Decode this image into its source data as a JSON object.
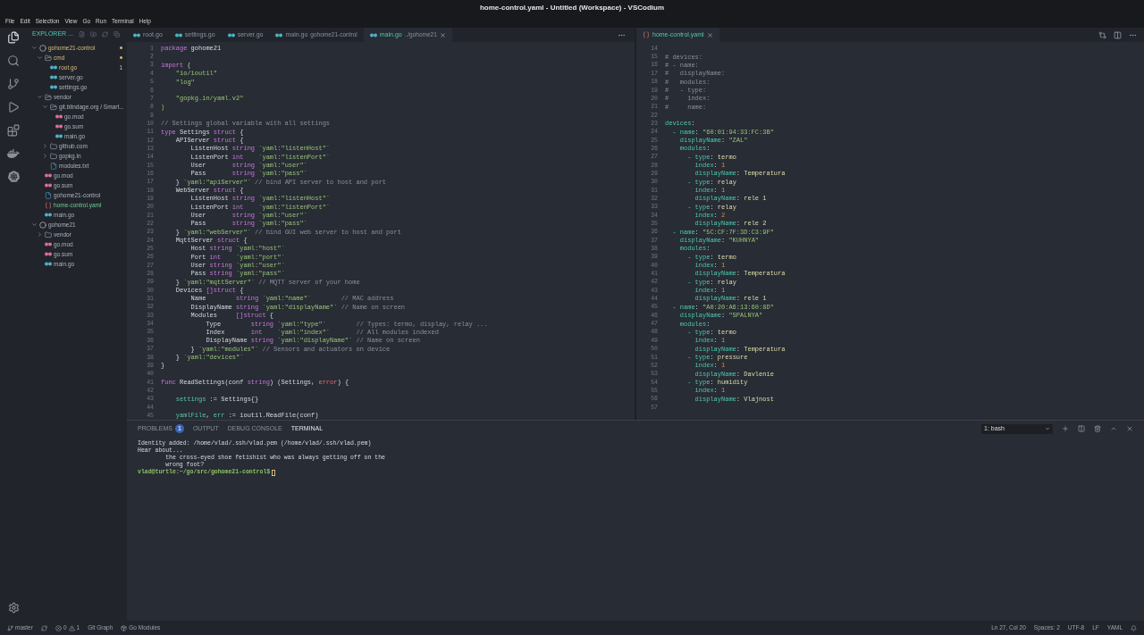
{
  "window": {
    "title": "home-control.yaml - Untitled (Workspace) - VSCodium"
  },
  "menu": [
    "File",
    "Edit",
    "Selection",
    "View",
    "Go",
    "Run",
    "Terminal",
    "Help"
  ],
  "sidebar": {
    "title": "EXPLORER ...",
    "tree": [
      {
        "label": "gohome21-control",
        "kind": "root",
        "expanded": true,
        "warning": true,
        "added": false,
        "children": [
          {
            "label": "cmd",
            "kind": "folder",
            "expanded": true,
            "warning": true,
            "added": false,
            "children": [
              {
                "label": "root.go",
                "kind": "go",
                "warning": true,
                "added": false,
                "badge": "1"
              },
              {
                "label": "server.go",
                "kind": "go",
                "warning": false,
                "added": false
              },
              {
                "label": "settings.go",
                "kind": "go",
                "warning": false,
                "added": false
              }
            ]
          },
          {
            "label": "vendor",
            "kind": "folder",
            "expanded": true,
            "warning": false,
            "added": false,
            "children": [
              {
                "label": "git.blindage.org / Smart...",
                "kind": "folder",
                "expanded": true,
                "warning": false,
                "added": false,
                "children": [
                  {
                    "label": "go.mod",
                    "kind": "mod",
                    "warning": false,
                    "added": false
                  },
                  {
                    "label": "go.sum",
                    "kind": "mod",
                    "warning": false,
                    "added": false
                  },
                  {
                    "label": "main.go",
                    "kind": "go",
                    "warning": false,
                    "added": false
                  }
                ]
              },
              {
                "label": "github.com",
                "kind": "folder",
                "expanded": false,
                "warning": false,
                "added": false
              },
              {
                "label": "gopkg.in",
                "kind": "folder",
                "expanded": false,
                "warning": false,
                "added": false
              },
              {
                "label": "modules.txt",
                "kind": "text",
                "warning": false,
                "added": false
              }
            ]
          },
          {
            "label": "go.mod",
            "kind": "mod",
            "warning": false,
            "added": false
          },
          {
            "label": "go.sum",
            "kind": "mod",
            "warning": false,
            "added": false
          },
          {
            "label": "gohome21-control",
            "kind": "text",
            "warning": false,
            "added": false
          },
          {
            "label": "home-control.yaml",
            "kind": "yaml",
            "warning": false,
            "added": true
          },
          {
            "label": "main.go",
            "kind": "go",
            "warning": false,
            "added": false
          }
        ]
      },
      {
        "label": "gohome21",
        "kind": "root",
        "expanded": true,
        "warning": false,
        "added": false,
        "children": [
          {
            "label": "vendor",
            "kind": "folder",
            "expanded": false,
            "warning": false,
            "added": false
          },
          {
            "label": "go.mod",
            "kind": "mod",
            "warning": false,
            "added": false
          },
          {
            "label": "go.sum",
            "kind": "mod",
            "warning": false,
            "added": false
          },
          {
            "label": "main.go",
            "kind": "go",
            "warning": false,
            "added": false
          }
        ]
      }
    ]
  },
  "editors": [
    {
      "tabs": [
        {
          "label": "root.go",
          "kind": "go",
          "selected": false
        },
        {
          "label": "settings.go",
          "kind": "go",
          "selected": false
        },
        {
          "label": "server.go",
          "kind": "go",
          "selected": false
        },
        {
          "label": "main.go",
          "description": "gohome21-control",
          "kind": "go",
          "selected": false
        },
        {
          "label": "main.go",
          "description": "../gohome21",
          "kind": "go",
          "selected": true
        }
      ],
      "lines": [
        {
          "number": "1",
          "tokens": [
            {
              "kind": "keyword",
              "text": "package"
            },
            {
              "kind": "plain",
              "text": " gohome21"
            }
          ]
        },
        {
          "number": "2"
        },
        {
          "number": "3",
          "tokens": [
            {
              "kind": "keyword",
              "text": "import"
            },
            {
              "kind": "plain",
              "text": " ("
            }
          ]
        },
        {
          "number": "4",
          "tokens": [
            {
              "kind": "string",
              "text": "    \"io/ioutil\""
            }
          ]
        },
        {
          "number": "5",
          "tokens": [
            {
              "kind": "string",
              "text": "    \"log\""
            }
          ]
        },
        {
          "number": "6"
        },
        {
          "number": "7",
          "tokens": [
            {
              "kind": "string",
              "text": "    \"gopkg.in/yaml.v2\""
            }
          ]
        },
        {
          "number": "8",
          "tokens": [
            {
              "kind": "string",
              "text": ")"
            }
          ]
        },
        {
          "number": "9"
        },
        {
          "number": "10",
          "tokens": [
            {
              "kind": "comment",
              "text": "// Settings global variable with all settings"
            }
          ]
        },
        {
          "number": "11",
          "tokens": [
            {
              "kind": "keyword",
              "text": "type"
            },
            {
              "kind": "plain",
              "text": " Settings "
            },
            {
              "kind": "keyword",
              "text": "struct"
            },
            {
              "kind": "plain",
              "text": " {"
            }
          ]
        },
        {
          "number": "12",
          "tokens": [
            {
              "kind": "plain",
              "text": "    APIServer "
            },
            {
              "kind": "keyword",
              "text": "struct"
            },
            {
              "kind": "plain",
              "text": " {"
            }
          ]
        },
        {
          "number": "13",
          "tokens": [
            {
              "kind": "plain",
              "text": "        ListenHost "
            },
            {
              "kind": "keyword",
              "text": "string"
            },
            {
              "kind": "string",
              "text": " `yaml:\"listenHost\"`"
            }
          ]
        },
        {
          "number": "14",
          "tokens": [
            {
              "kind": "plain",
              "text": "        ListenPort "
            },
            {
              "kind": "keyword",
              "text": "int"
            },
            {
              "kind": "string",
              "text": "    `yaml:\"listenPort\"`"
            }
          ]
        },
        {
          "number": "15",
          "tokens": [
            {
              "kind": "plain",
              "text": "        User       "
            },
            {
              "kind": "keyword",
              "text": "string"
            },
            {
              "kind": "string",
              "text": " `yaml:\"user\"`"
            }
          ]
        },
        {
          "number": "16",
          "tokens": [
            {
              "kind": "plain",
              "text": "        Pass       "
            },
            {
              "kind": "keyword",
              "text": "string"
            },
            {
              "kind": "string",
              "text": " `yaml:\"pass\"`"
            }
          ]
        },
        {
          "number": "17",
          "tokens": [
            {
              "kind": "plain",
              "text": "    } "
            },
            {
              "kind": "string",
              "text": "`yaml:\"apiServer\"`"
            },
            {
              "kind": "comment",
              "text": " // bind API server to host and port"
            }
          ]
        },
        {
          "number": "18",
          "tokens": [
            {
              "kind": "plain",
              "text": "    WebServer "
            },
            {
              "kind": "keyword",
              "text": "struct"
            },
            {
              "kind": "plain",
              "text": " {"
            }
          ]
        },
        {
          "number": "19",
          "tokens": [
            {
              "kind": "plain",
              "text": "        ListenHost "
            },
            {
              "kind": "keyword",
              "text": "string"
            },
            {
              "kind": "string",
              "text": " `yaml:\"listenHost\"`"
            }
          ]
        },
        {
          "number": "20",
          "tokens": [
            {
              "kind": "plain",
              "text": "        ListenPort "
            },
            {
              "kind": "keyword",
              "text": "int"
            },
            {
              "kind": "string",
              "text": "    `yaml:\"listenPort\"`"
            }
          ]
        },
        {
          "number": "21",
          "tokens": [
            {
              "kind": "plain",
              "text": "        User       "
            },
            {
              "kind": "keyword",
              "text": "string"
            },
            {
              "kind": "string",
              "text": " `yaml:\"user\"`"
            }
          ]
        },
        {
          "number": "22",
          "tokens": [
            {
              "kind": "plain",
              "text": "        Pass       "
            },
            {
              "kind": "keyword",
              "text": "string"
            },
            {
              "kind": "string",
              "text": " `yaml:\"pass\"`"
            }
          ]
        },
        {
          "number": "23",
          "tokens": [
            {
              "kind": "plain",
              "text": "    } "
            },
            {
              "kind": "string",
              "text": "`yaml:\"webServer\"`"
            },
            {
              "kind": "comment",
              "text": " // bind GUI web server to host and port"
            }
          ]
        },
        {
          "number": "24",
          "tokens": [
            {
              "kind": "plain",
              "text": "    MqttServer "
            },
            {
              "kind": "keyword",
              "text": "struct"
            },
            {
              "kind": "plain",
              "text": " {"
            }
          ]
        },
        {
          "number": "25",
          "tokens": [
            {
              "kind": "plain",
              "text": "        Host "
            },
            {
              "kind": "keyword",
              "text": "string"
            },
            {
              "kind": "string",
              "text": " `yaml:\"host\"`"
            }
          ]
        },
        {
          "number": "26",
          "tokens": [
            {
              "kind": "plain",
              "text": "        Port "
            },
            {
              "kind": "keyword",
              "text": "int"
            },
            {
              "kind": "string",
              "text": "    `yaml:\"port\"`"
            }
          ]
        },
        {
          "number": "27",
          "tokens": [
            {
              "kind": "plain",
              "text": "        User "
            },
            {
              "kind": "keyword",
              "text": "string"
            },
            {
              "kind": "string",
              "text": " `yaml:\"user\"`"
            }
          ]
        },
        {
          "number": "28",
          "tokens": [
            {
              "kind": "plain",
              "text": "        Pass "
            },
            {
              "kind": "keyword",
              "text": "string"
            },
            {
              "kind": "string",
              "text": " `yaml:\"pass\"`"
            }
          ]
        },
        {
          "number": "29",
          "tokens": [
            {
              "kind": "plain",
              "text": "    } "
            },
            {
              "kind": "string",
              "text": "`yaml:\"mqttServer\"`"
            },
            {
              "kind": "comment",
              "text": " // MQTT server of your home"
            }
          ]
        },
        {
          "number": "30",
          "tokens": [
            {
              "kind": "plain",
              "text": "    Devices "
            },
            {
              "kind": "keyword",
              "text": "[]struct"
            },
            {
              "kind": "plain",
              "text": " {"
            }
          ]
        },
        {
          "number": "31",
          "tokens": [
            {
              "kind": "plain",
              "text": "        Name        "
            },
            {
              "kind": "keyword",
              "text": "string"
            },
            {
              "kind": "string",
              "text": " `yaml:\"name\"`"
            },
            {
              "kind": "comment",
              "text": "        // MAC address"
            }
          ]
        },
        {
          "number": "32",
          "tokens": [
            {
              "kind": "plain",
              "text": "        DisplayName "
            },
            {
              "kind": "keyword",
              "text": "string"
            },
            {
              "kind": "string",
              "text": " `yaml:\"displayName\"`"
            },
            {
              "kind": "comment",
              "text": " // Name on screen"
            }
          ]
        },
        {
          "number": "33",
          "tokens": [
            {
              "kind": "plain",
              "text": "        Modules     "
            },
            {
              "kind": "keyword",
              "text": "[]struct"
            },
            {
              "kind": "plain",
              "text": " {"
            }
          ]
        },
        {
          "number": "34",
          "tokens": [
            {
              "kind": "plain",
              "text": "            Type        "
            },
            {
              "kind": "keyword",
              "text": "string"
            },
            {
              "kind": "string",
              "text": " `yaml:\"type\"`"
            },
            {
              "kind": "comment",
              "text": "        // Types: termo, display, relay ..."
            }
          ]
        },
        {
          "number": "35",
          "tokens": [
            {
              "kind": "plain",
              "text": "            Index       "
            },
            {
              "kind": "keyword",
              "text": "int"
            },
            {
              "kind": "string",
              "text": "    `yaml:\"index\"`"
            },
            {
              "kind": "comment",
              "text": "       // All modules indexed"
            }
          ]
        },
        {
          "number": "36",
          "tokens": [
            {
              "kind": "plain",
              "text": "            DisplayName "
            },
            {
              "kind": "keyword",
              "text": "string"
            },
            {
              "kind": "string",
              "text": " `yaml:\"displayName\"`"
            },
            {
              "kind": "comment",
              "text": " // Name on screen"
            }
          ]
        },
        {
          "number": "37",
          "tokens": [
            {
              "kind": "plain",
              "text": "        } "
            },
            {
              "kind": "string",
              "text": "`yaml:\"modules\"`"
            },
            {
              "kind": "comment",
              "text": " // Sensors and actuators on device"
            }
          ]
        },
        {
          "number": "38",
          "tokens": [
            {
              "kind": "plain",
              "text": "    } "
            },
            {
              "kind": "string",
              "text": "`yaml:\"devices\"`"
            }
          ]
        },
        {
          "number": "39",
          "tokens": [
            {
              "kind": "plain",
              "text": "}"
            }
          ]
        },
        {
          "number": "40"
        },
        {
          "number": "41",
          "tokens": [
            {
              "kind": "keyword",
              "text": "func"
            },
            {
              "kind": "plain",
              "text": " ReadSettings(conf "
            },
            {
              "kind": "keyword",
              "text": "string"
            },
            {
              "kind": "plain",
              "text": ") (Settings, "
            },
            {
              "kind": "builtin",
              "text": "error"
            },
            {
              "kind": "plain",
              "text": ") {"
            }
          ]
        },
        {
          "number": "42"
        },
        {
          "number": "43",
          "tokens": [
            {
              "kind": "variable",
              "text": "    settings"
            },
            {
              "kind": "plain",
              "text": " := Settings{}"
            }
          ]
        },
        {
          "number": "44"
        },
        {
          "number": "45",
          "tokens": [
            {
              "kind": "variable",
              "text": "    yamlFile"
            },
            {
              "kind": "plain",
              "text": ", "
            },
            {
              "kind": "variable",
              "text": "err"
            },
            {
              "kind": "plain",
              "text": " := ioutil.ReadFile(conf)"
            }
          ]
        }
      ]
    },
    {
      "tabs": [
        {
          "label": "home-control.yaml",
          "kind": "yaml",
          "selected": true
        }
      ],
      "lines": [
        {
          "number": "14"
        },
        {
          "number": "15",
          "tokens": [
            {
              "kind": "comment",
              "text": "# devices:"
            }
          ]
        },
        {
          "number": "16",
          "tokens": [
            {
              "kind": "comment",
              "text": "# - name:"
            }
          ]
        },
        {
          "number": "17",
          "tokens": [
            {
              "kind": "comment",
              "text": "#   displayName:"
            }
          ]
        },
        {
          "number": "18",
          "tokens": [
            {
              "kind": "comment",
              "text": "#   modules:"
            }
          ]
        },
        {
          "number": "19",
          "tokens": [
            {
              "kind": "comment",
              "text": "#   - type:"
            }
          ]
        },
        {
          "number": "20",
          "tokens": [
            {
              "kind": "comment",
              "text": "#     index:"
            }
          ]
        },
        {
          "number": "21",
          "tokens": [
            {
              "kind": "comment",
              "text": "#     name:"
            }
          ]
        },
        {
          "number": "22"
        },
        {
          "number": "23",
          "tokens": [
            {
              "kind": "key",
              "text": "devices"
            },
            {
              "kind": "plain",
              "text": ":"
            }
          ]
        },
        {
          "number": "24",
          "tokens": [
            {
              "kind": "key",
              "text": "  - name"
            },
            {
              "kind": "plain",
              "text": ": "
            },
            {
              "kind": "string",
              "text": "\"60:01:94:33:FC:3B\""
            }
          ]
        },
        {
          "number": "25",
          "tokens": [
            {
              "kind": "key",
              "text": "    displayName"
            },
            {
              "kind": "plain",
              "text": ": "
            },
            {
              "kind": "string",
              "text": "\"ZAL\""
            }
          ]
        },
        {
          "number": "26",
          "tokens": [
            {
              "kind": "key",
              "text": "    modules"
            },
            {
              "kind": "plain",
              "text": ":"
            }
          ]
        },
        {
          "number": "27",
          "tokens": [
            {
              "kind": "key",
              "text": "      - type"
            },
            {
              "kind": "plain",
              "text": ": "
            },
            {
              "kind": "value",
              "text": "termo"
            }
          ]
        },
        {
          "number": "28",
          "tokens": [
            {
              "kind": "key",
              "text": "        index"
            },
            {
              "kind": "plain",
              "text": ": "
            },
            {
              "kind": "number",
              "text": "1"
            }
          ]
        },
        {
          "number": "29",
          "tokens": [
            {
              "kind": "key",
              "text": "        displayName"
            },
            {
              "kind": "plain",
              "text": ": "
            },
            {
              "kind": "value",
              "text": "Temperatura"
            }
          ]
        },
        {
          "number": "30",
          "tokens": [
            {
              "kind": "key",
              "text": "      - type"
            },
            {
              "kind": "plain",
              "text": ": "
            },
            {
              "kind": "value",
              "text": "relay"
            }
          ]
        },
        {
          "number": "31",
          "tokens": [
            {
              "kind": "key",
              "text": "        index"
            },
            {
              "kind": "plain",
              "text": ": "
            },
            {
              "kind": "number",
              "text": "1"
            }
          ]
        },
        {
          "number": "32",
          "tokens": [
            {
              "kind": "key",
              "text": "        displayName"
            },
            {
              "kind": "plain",
              "text": ": "
            },
            {
              "kind": "value",
              "text": "rele 1"
            }
          ]
        },
        {
          "number": "33",
          "tokens": [
            {
              "kind": "key",
              "text": "      - type"
            },
            {
              "kind": "plain",
              "text": ": "
            },
            {
              "kind": "value",
              "text": "relay"
            }
          ]
        },
        {
          "number": "34",
          "tokens": [
            {
              "kind": "key",
              "text": "        index"
            },
            {
              "kind": "plain",
              "text": ": "
            },
            {
              "kind": "number",
              "text": "2"
            }
          ]
        },
        {
          "number": "35",
          "tokens": [
            {
              "kind": "key",
              "text": "        displayName"
            },
            {
              "kind": "plain",
              "text": ": "
            },
            {
              "kind": "value",
              "text": "rele 2"
            }
          ]
        },
        {
          "number": "36",
          "tokens": [
            {
              "kind": "key",
              "text": "  - name"
            },
            {
              "kind": "plain",
              "text": ": "
            },
            {
              "kind": "string",
              "text": "\"5C:CF:7F:3D:C3:9F\""
            }
          ]
        },
        {
          "number": "37",
          "tokens": [
            {
              "kind": "key",
              "text": "    displayName"
            },
            {
              "kind": "plain",
              "text": ": "
            },
            {
              "kind": "string",
              "text": "\"KUHNYA\""
            }
          ]
        },
        {
          "number": "38",
          "tokens": [
            {
              "kind": "key",
              "text": "    modules"
            },
            {
              "kind": "plain",
              "text": ":"
            }
          ]
        },
        {
          "number": "39",
          "tokens": [
            {
              "kind": "key",
              "text": "      - type"
            },
            {
              "kind": "plain",
              "text": ": "
            },
            {
              "kind": "value",
              "text": "termo"
            }
          ]
        },
        {
          "number": "40",
          "tokens": [
            {
              "kind": "key",
              "text": "        index"
            },
            {
              "kind": "plain",
              "text": ": "
            },
            {
              "kind": "number",
              "text": "1"
            }
          ]
        },
        {
          "number": "41",
          "tokens": [
            {
              "kind": "key",
              "text": "        displayName"
            },
            {
              "kind": "plain",
              "text": ": "
            },
            {
              "kind": "value",
              "text": "Temperatura"
            }
          ]
        },
        {
          "number": "42",
          "tokens": [
            {
              "kind": "key",
              "text": "      - type"
            },
            {
              "kind": "plain",
              "text": ": "
            },
            {
              "kind": "value",
              "text": "relay"
            }
          ]
        },
        {
          "number": "43",
          "tokens": [
            {
              "kind": "key",
              "text": "        index"
            },
            {
              "kind": "plain",
              "text": ": "
            },
            {
              "kind": "number",
              "text": "1"
            }
          ]
        },
        {
          "number": "44",
          "tokens": [
            {
              "kind": "key",
              "text": "        displayName"
            },
            {
              "kind": "plain",
              "text": ": "
            },
            {
              "kind": "value",
              "text": "rele 1"
            }
          ]
        },
        {
          "number": "45",
          "tokens": [
            {
              "kind": "key",
              "text": "  - name"
            },
            {
              "kind": "plain",
              "text": ": "
            },
            {
              "kind": "string",
              "text": "\"A0:20:A6:13:60:8D\""
            }
          ]
        },
        {
          "number": "46",
          "tokens": [
            {
              "kind": "key",
              "text": "    displayName"
            },
            {
              "kind": "plain",
              "text": ": "
            },
            {
              "kind": "string",
              "text": "\"SPALNYA\""
            }
          ]
        },
        {
          "number": "47",
          "tokens": [
            {
              "kind": "key",
              "text": "    modules"
            },
            {
              "kind": "plain",
              "text": ":"
            }
          ]
        },
        {
          "number": "48",
          "tokens": [
            {
              "kind": "key",
              "text": "      - type"
            },
            {
              "kind": "plain",
              "text": ": "
            },
            {
              "kind": "value",
              "text": "termo"
            }
          ]
        },
        {
          "number": "49",
          "tokens": [
            {
              "kind": "key",
              "text": "        index"
            },
            {
              "kind": "plain",
              "text": ": "
            },
            {
              "kind": "number",
              "text": "1"
            }
          ]
        },
        {
          "number": "50",
          "tokens": [
            {
              "kind": "key",
              "text": "        displayName"
            },
            {
              "kind": "plain",
              "text": ": "
            },
            {
              "kind": "value",
              "text": "Temperatura"
            }
          ]
        },
        {
          "number": "51",
          "tokens": [
            {
              "kind": "key",
              "text": "      - type"
            },
            {
              "kind": "plain",
              "text": ": "
            },
            {
              "kind": "value",
              "text": "pressure"
            }
          ]
        },
        {
          "number": "52",
          "tokens": [
            {
              "kind": "key",
              "text": "        index"
            },
            {
              "kind": "plain",
              "text": ": "
            },
            {
              "kind": "number",
              "text": "1"
            }
          ]
        },
        {
          "number": "53",
          "tokens": [
            {
              "kind": "key",
              "text": "        displayName"
            },
            {
              "kind": "plain",
              "text": ": "
            },
            {
              "kind": "value",
              "text": "Davlenie"
            }
          ]
        },
        {
          "number": "54",
          "tokens": [
            {
              "kind": "key",
              "text": "      - type"
            },
            {
              "kind": "plain",
              "text": ": "
            },
            {
              "kind": "value",
              "text": "humidity"
            }
          ]
        },
        {
          "number": "55",
          "tokens": [
            {
              "kind": "key",
              "text": "        index"
            },
            {
              "kind": "plain",
              "text": ": "
            },
            {
              "kind": "number",
              "text": "1"
            }
          ]
        },
        {
          "number": "56",
          "tokens": [
            {
              "kind": "key",
              "text": "        displayName"
            },
            {
              "kind": "plain",
              "text": ": "
            },
            {
              "kind": "value",
              "text": "Vlajnost"
            }
          ]
        },
        {
          "number": "57"
        }
      ]
    }
  ],
  "panel": {
    "tabs": [
      {
        "label": "PROBLEMS",
        "badge": "1",
        "selected": false
      },
      {
        "label": "OUTPUT",
        "selected": false
      },
      {
        "label": "DEBUG CONSOLE",
        "selected": false
      },
      {
        "label": "TERMINAL",
        "selected": true
      }
    ],
    "terminal_select": "1: bash",
    "terminal": {
      "lines": [
        "Identity added: /home/vlad/.ssh/vlad.pem (/home/vlad/.ssh/vlad.pem)",
        "Hear about...",
        "        the cross-eyed shoe fetishist who was always getting off on the",
        "        wrong foot?"
      ],
      "prompt": "vlad@turtle:~/go/src/gohome21-control$"
    }
  },
  "status_bar": {
    "branch": "master",
    "errors": "0",
    "warnings": "1",
    "items": [
      {
        "label": "Git Graph",
        "kind": "plain"
      },
      {
        "label": "Go Modules",
        "kind": "modules"
      }
    ],
    "right": [
      "Ln 27, Col 20",
      "Spaces: 2",
      "UTF-8",
      "LF",
      "YAML"
    ]
  }
}
